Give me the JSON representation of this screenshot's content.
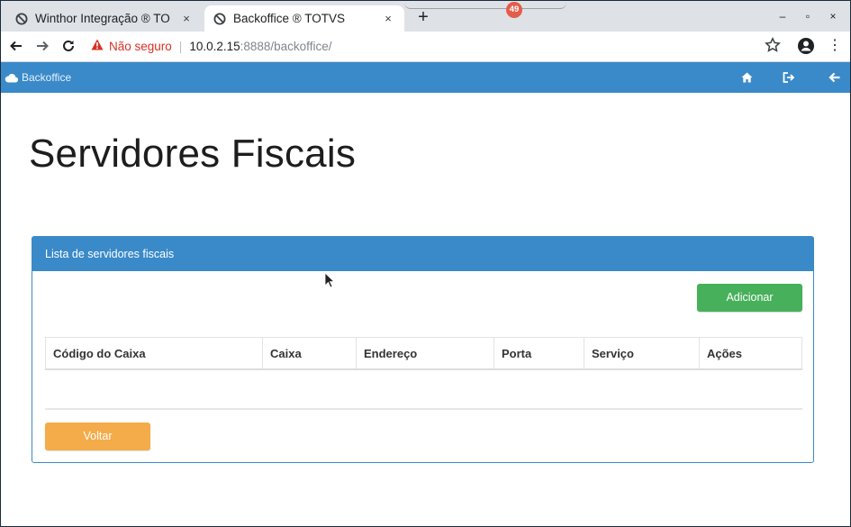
{
  "browser": {
    "tabs": [
      {
        "title": "Winthor Integração ® TO",
        "active": false,
        "close": "×"
      },
      {
        "title": "Backoffice ® TOTVS",
        "active": true,
        "close": "×"
      }
    ],
    "new_tab": "+",
    "notification_badge": "49",
    "window_controls": {
      "minimize": "–",
      "maximize": "▫",
      "close": "×"
    },
    "address": {
      "security_label": "Não seguro",
      "separator": "|",
      "host": "10.0.2.15",
      "rest": ":8888/backoffice/"
    },
    "menu": "⋮"
  },
  "appbar": {
    "brand": "Backoffice",
    "icons": [
      "home-icon",
      "logout-icon",
      "back-arrow-icon"
    ],
    "color": "#3a8ac9"
  },
  "page": {
    "title": "Servidores Fiscais",
    "panel": {
      "heading": "Lista de servidores fiscais",
      "add_button": "Adicionar",
      "back_button": "Voltar",
      "columns": [
        "Código do Caixa",
        "Caixa",
        "Endereço",
        "Porta",
        "Serviço",
        "Ações"
      ],
      "rows": []
    }
  },
  "colors": {
    "primary": "#3a8ac9",
    "success": "#46b05a",
    "warning": "#f4ab4a",
    "insecure": "#d93025"
  }
}
